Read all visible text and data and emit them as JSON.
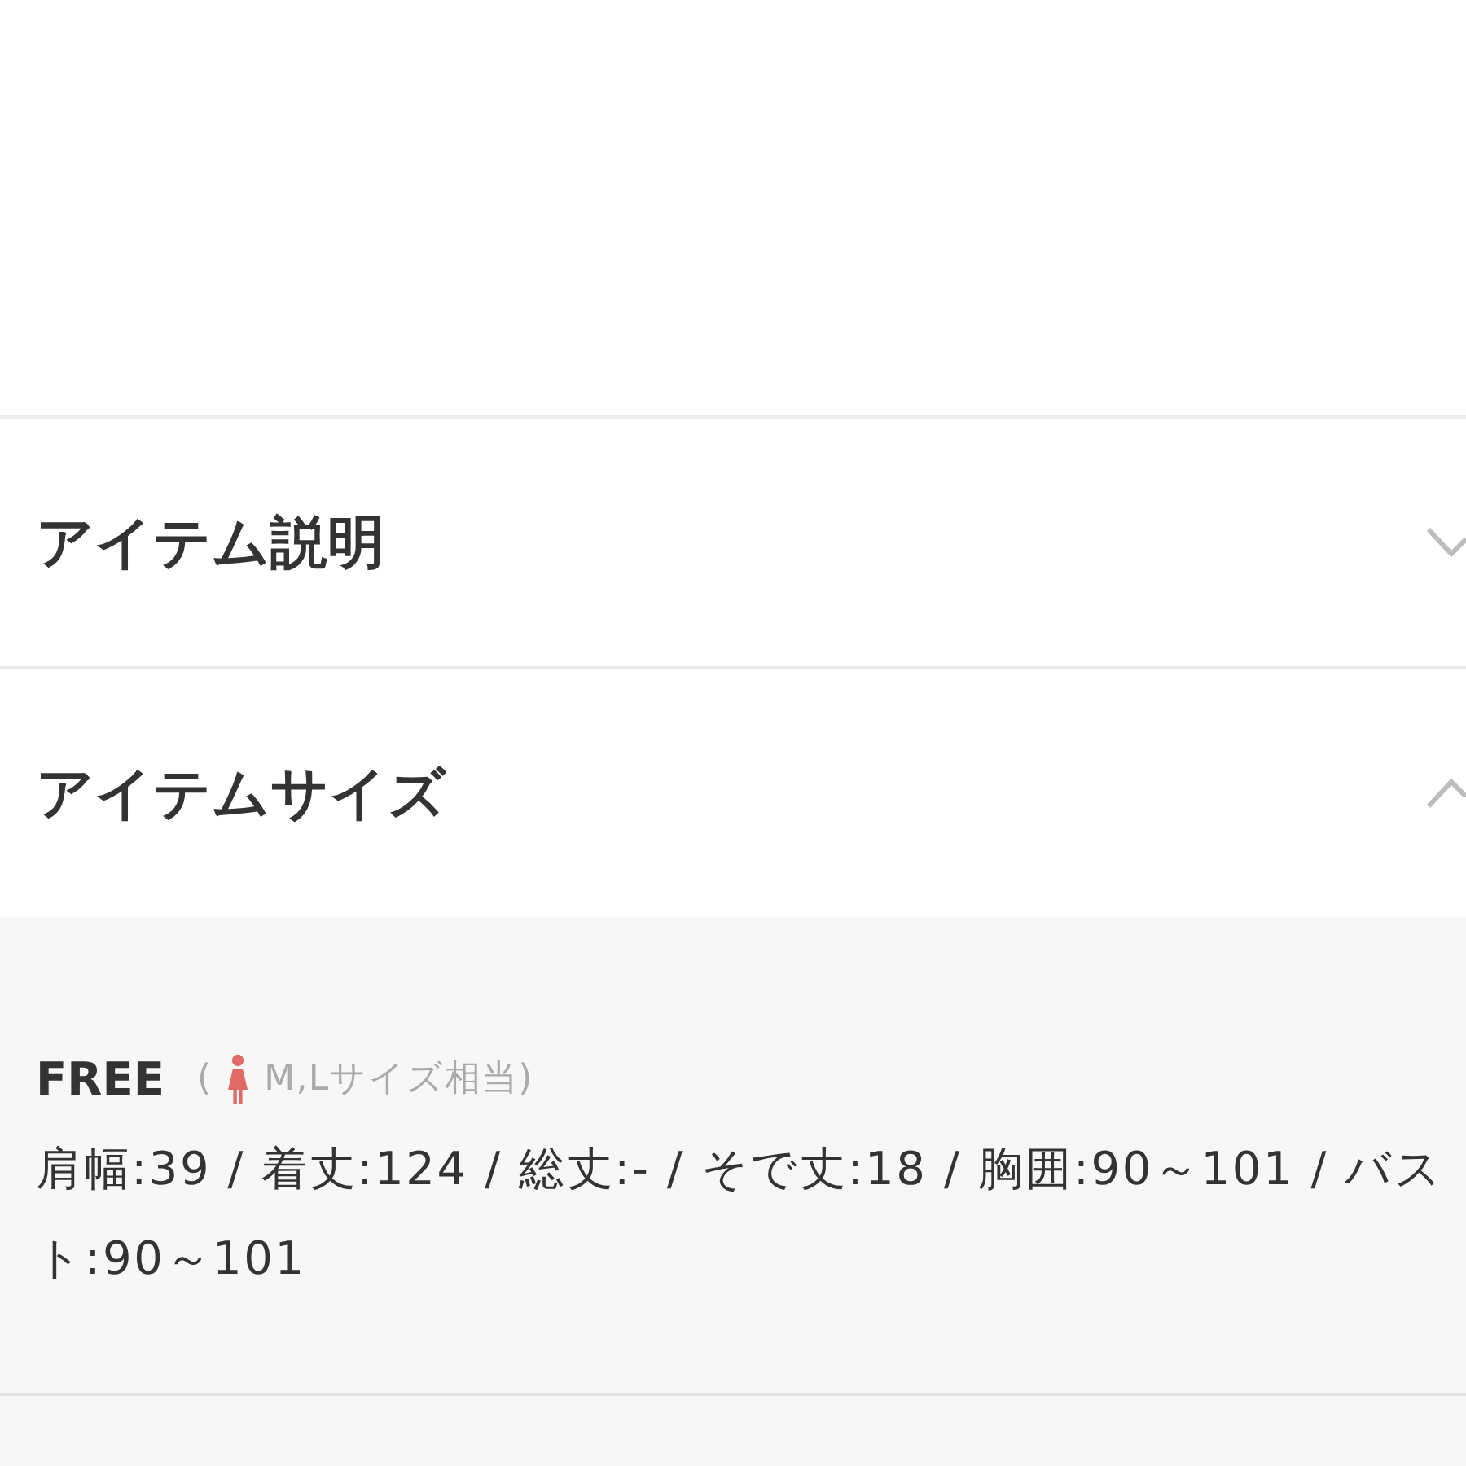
{
  "sections": [
    {
      "title": "アイテム説明",
      "expanded": false
    },
    {
      "title": "アイテムサイズ",
      "expanded": true,
      "size": {
        "label": "FREE",
        "note_open": "(",
        "note": "M,Lサイズ相当)",
        "measurements": "肩幅:39 / 着丈:124 / 総丈:- / そで丈:18 / 胸囲:90～101 / バスト:90～101"
      }
    }
  ]
}
